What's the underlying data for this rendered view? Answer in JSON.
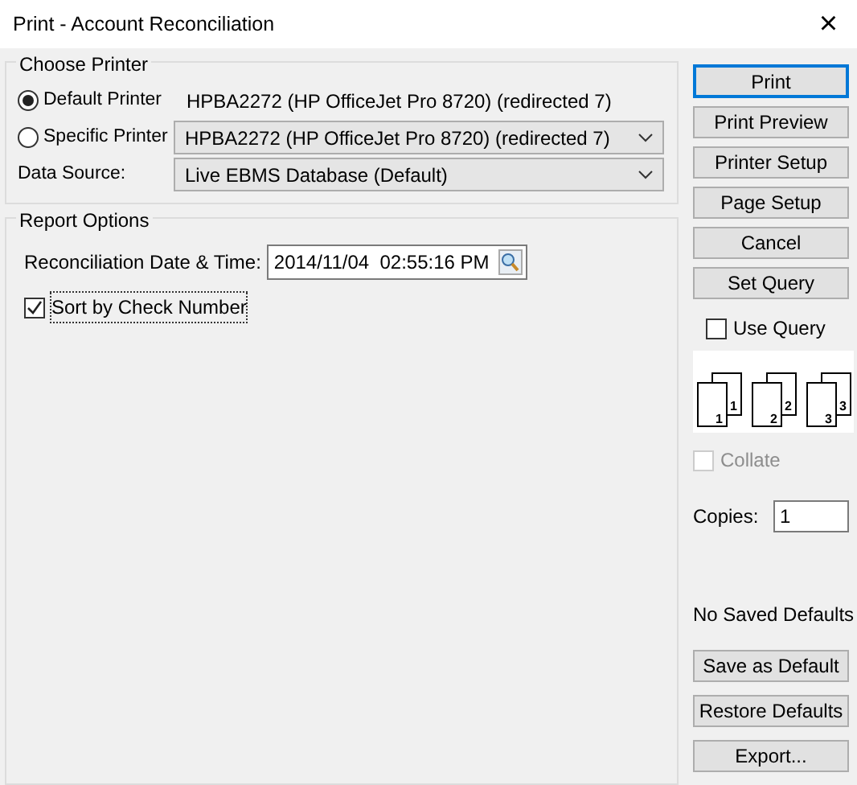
{
  "window": {
    "title": "Print - Account Reconciliation",
    "close": "×"
  },
  "choose_printer": {
    "title": "Choose Printer",
    "options": [
      {
        "label": "Default Printer",
        "selected": true,
        "kind": "text",
        "value": "HPBA2272 (HP OfficeJet Pro 8720) (redirected 7)"
      },
      {
        "label": "Specific Printer",
        "selected": false,
        "kind": "dropdown",
        "value": "HPBA2272 (HP OfficeJet Pro 8720) (redirected 7)"
      }
    ],
    "data_source": {
      "label": "Data Source:",
      "value": "Live EBMS Database (Default)"
    }
  },
  "report_options": {
    "title": "Report Options",
    "date_label": "Reconciliation Date & Time:",
    "date_value": "2014/11/04  02:55:16 PM",
    "sort_by_check": {
      "label": "Sort by Check Number",
      "checked": true
    }
  },
  "top_buttons": [
    "Print",
    "Print Preview",
    "Printer Setup",
    "Page Setup",
    "Cancel",
    "Set Query"
  ],
  "use_query": {
    "label": "Use Query",
    "checked": false
  },
  "collate_pages": [
    {
      "back": "1",
      "front": "1"
    },
    {
      "back": "2",
      "front": "2"
    },
    {
      "back": "3",
      "front": "3"
    }
  ],
  "collate": {
    "label": "Collate",
    "checked": false,
    "disabled": true
  },
  "copies": {
    "label": "Copies:",
    "value": "1"
  },
  "defaults_status": "No Saved Defaults",
  "bottom_buttons": [
    "Save as Default",
    "Restore Defaults",
    "Export..."
  ]
}
